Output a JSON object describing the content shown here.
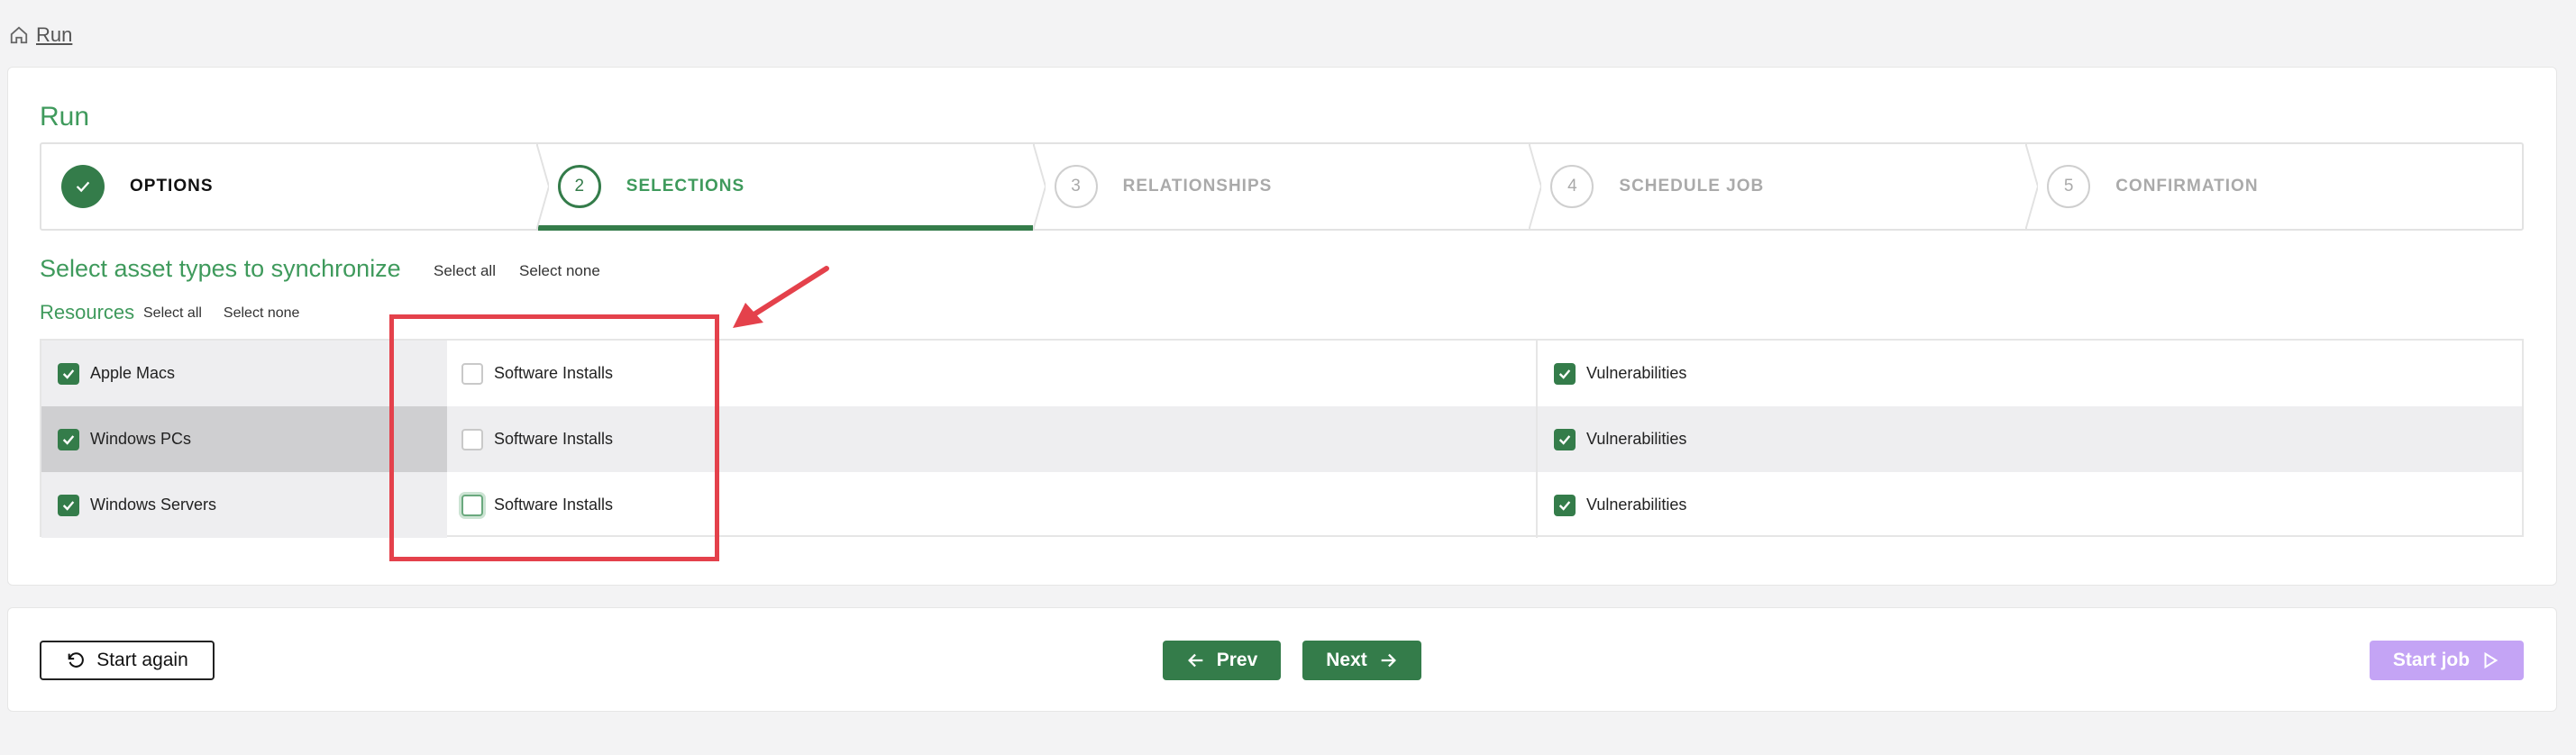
{
  "breadcrumb": {
    "items": [
      "Run"
    ]
  },
  "page": {
    "title": "Run"
  },
  "stepper": {
    "steps": [
      {
        "number": "",
        "label": "OPTIONS",
        "state": "done"
      },
      {
        "number": "2",
        "label": "SELECTIONS",
        "state": "active"
      },
      {
        "number": "3",
        "label": "RELATIONSHIPS",
        "state": "pending"
      },
      {
        "number": "4",
        "label": "SCHEDULE JOB",
        "state": "pending"
      },
      {
        "number": "5",
        "label": "CONFIRMATION",
        "state": "pending"
      }
    ]
  },
  "assets": {
    "title": "Select asset types to synchronize",
    "select_all": "Select all",
    "select_none": "Select none"
  },
  "resources": {
    "title": "Resources",
    "select_all": "Select all",
    "select_none": "Select none",
    "rows": [
      {
        "name": "Apple Macs",
        "name_checked": true,
        "software": "Software Installs",
        "software_checked": false,
        "vuln": "Vulnerabilities",
        "vuln_checked": true
      },
      {
        "name": "Windows PCs",
        "name_checked": true,
        "software": "Software Installs",
        "software_checked": false,
        "vuln": "Vulnerabilities",
        "vuln_checked": true
      },
      {
        "name": "Windows Servers",
        "name_checked": true,
        "software": "Software Installs",
        "software_checked": false,
        "vuln": "Vulnerabilities",
        "vuln_checked": true
      }
    ]
  },
  "footer": {
    "start_again": "Start again",
    "prev": "Prev",
    "next": "Next",
    "start_job": "Start job"
  },
  "colors": {
    "brand_green": "#347c4a",
    "title_green": "#3f9a5c",
    "start_job_disabled": "#c4a4f5",
    "annotation_red": "#e4414b"
  }
}
